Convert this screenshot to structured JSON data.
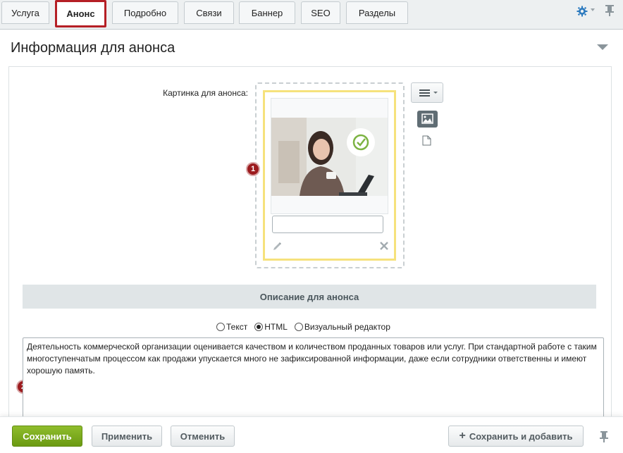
{
  "tabs": [
    {
      "label": "Услуга",
      "active": false
    },
    {
      "label": "Анонс",
      "active": true
    },
    {
      "label": "Подробно",
      "active": false
    },
    {
      "label": "Связи",
      "active": false
    },
    {
      "label": "Баннер",
      "active": false
    },
    {
      "label": "SEO",
      "active": false
    },
    {
      "label": "Разделы",
      "active": false
    }
  ],
  "section": {
    "title": "Информация для анонса"
  },
  "picture": {
    "label": "Картинка для анонса:",
    "description_value": ""
  },
  "markers": [
    "1",
    "2"
  ],
  "description": {
    "header": "Описание для анонса",
    "modes": [
      {
        "label": "Текст",
        "checked": false
      },
      {
        "label": "HTML",
        "checked": true
      },
      {
        "label": "Визуальный редактор",
        "checked": false
      }
    ],
    "text": "Деятельность коммерческой организации оценивается качеством и количеством проданных товаров или услуг. При стандартной работе с таким многоступенчатым процессом как продажи упускается много не зафиксированной информации, даже если сотрудники ответственны и имеют хорошую память."
  },
  "footer": {
    "save_label": "Сохранить",
    "apply_label": "Применить",
    "cancel_label": "Отменить",
    "save_add_label": "Сохранить и добавить"
  },
  "icons": {
    "settings": "gear-icon",
    "pin": "pin-icon",
    "collapse": "triangle-down-icon",
    "menu": "hamburger-icon",
    "image_mode": "image-icon",
    "file_mode": "file-icon",
    "edit": "pencil-icon",
    "delete": "close-icon",
    "add": "plus-icon"
  },
  "colors": {
    "accent_red": "#b51f25",
    "marker": "#9c1b1e",
    "save_green": "#7aa81e",
    "highlight_yellow": "#f6e27c"
  }
}
